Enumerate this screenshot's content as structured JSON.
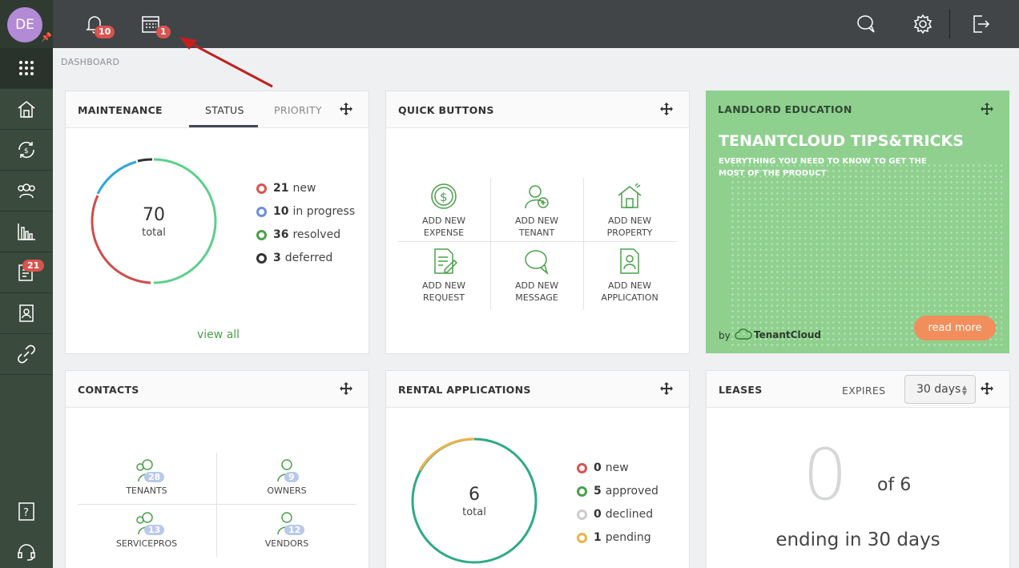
{
  "user": {
    "initials": "DE"
  },
  "sidebar": {
    "badge_tasks": "21"
  },
  "topbar": {
    "notifications_count": "10",
    "calendar_count": "1"
  },
  "breadcrumb": "DASHBOARD",
  "maintenance": {
    "title": "MAINTENANCE",
    "tabs": [
      "STATUS",
      "PRIORITY"
    ],
    "total": "70",
    "total_label": "total",
    "legend": [
      {
        "count": "21",
        "label": "new",
        "color": "#d9534f"
      },
      {
        "count": "10",
        "label": "in progress",
        "color": "#6b8fd8"
      },
      {
        "count": "36",
        "label": "resolved",
        "color": "#4aa04a"
      },
      {
        "count": "3",
        "label": "deferred",
        "color": "#333333"
      }
    ],
    "view_all": "view all"
  },
  "quick_buttons": {
    "title": "QUICK BUTTONS",
    "items": [
      {
        "line1": "ADD NEW",
        "line2": "EXPENSE",
        "icon": "dollar-circle-icon"
      },
      {
        "line1": "ADD NEW",
        "line2": "TENANT",
        "icon": "add-user-icon"
      },
      {
        "line1": "ADD NEW",
        "line2": "PROPERTY",
        "icon": "house-icon"
      },
      {
        "line1": "ADD NEW",
        "line2": "REQUEST",
        "icon": "edit-document-icon"
      },
      {
        "line1": "ADD NEW",
        "line2": "MESSAGE",
        "icon": "chat-icon"
      },
      {
        "line1": "ADD NEW",
        "line2": "APPLICATION",
        "icon": "application-icon"
      }
    ]
  },
  "education": {
    "title": "LANDLORD EDUCATION",
    "heading": "TENANTCLOUD TIPS&TRICKS",
    "subheading": "EVERYTHING YOU NEED TO KNOW TO GET THE MOST OF THE PRODUCT",
    "by": "by",
    "brand": "TenantCloud",
    "read_more": "read more"
  },
  "contacts": {
    "title": "CONTACTS",
    "items": [
      {
        "label": "TENANTS",
        "count": "28"
      },
      {
        "label": "OWNERS",
        "count": "9"
      },
      {
        "label": "SERVICEPROS",
        "count": "13"
      },
      {
        "label": "VENDORS",
        "count": "12"
      }
    ]
  },
  "rental_applications": {
    "title": "RENTAL APPLICATIONS",
    "total": "6",
    "total_label": "total",
    "legend": [
      {
        "count": "0",
        "label": "new",
        "color": "#d9534f"
      },
      {
        "count": "5",
        "label": "approved",
        "color": "#4aa04a"
      },
      {
        "count": "0",
        "label": "declined",
        "color": "#cccccc"
      },
      {
        "count": "1",
        "label": "pending",
        "color": "#f0b24a"
      }
    ]
  },
  "leases": {
    "title": "LEASES",
    "expires_label": "EXPIRES",
    "select_value": "30 days",
    "count": "0",
    "of_total": "of 6",
    "caption": "ending in 30 days"
  }
}
